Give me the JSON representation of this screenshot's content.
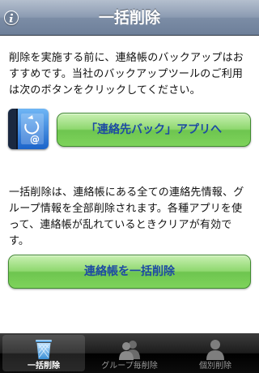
{
  "navbar": {
    "title": "一括削除",
    "info_icon": "info-icon"
  },
  "main": {
    "backup_notice": "削除を実施する前に、連絡帳のバックアップはおすすめです。当社のバックアップツールのご利用は次のボタンをクリックしてください。",
    "backup_button_label": "「連絡先バック」アプリへ",
    "app_icon": "contacts-backup-app-icon",
    "delete_notice": "一括削除は、連絡帳にある全ての連絡先情報、グループ情報を全部削除されます。各種アプリを使って、連絡帳が乱れているときクリアが有効です。",
    "delete_button_label": "連絡帳を一括削除"
  },
  "tabbar": {
    "tabs": [
      {
        "label": "一括削除",
        "icon": "trash-icon",
        "selected": true
      },
      {
        "label": "グループ毎削除",
        "icon": "group-icon",
        "selected": false
      },
      {
        "label": "個別削除",
        "icon": "person-icon",
        "selected": false
      }
    ]
  },
  "colors": {
    "button_text": "#1d4aa3",
    "button_green": "#7ed35b",
    "navbar": "#8a9ab1"
  }
}
